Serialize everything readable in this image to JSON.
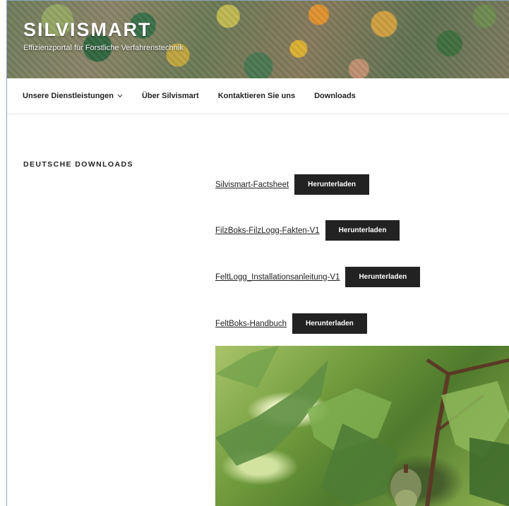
{
  "header": {
    "title": "SILVISMART",
    "tagline": "Effizienzportal für Forstliche Verfahrenstechnik"
  },
  "nav": {
    "items": [
      {
        "label": "Unsere Dienstleistungen",
        "has_dropdown": true
      },
      {
        "label": "Über Silvismart"
      },
      {
        "label": "Kontaktieren Sie uns"
      },
      {
        "label": "Downloads"
      }
    ]
  },
  "content": {
    "section_title": "DEUTSCHE DOWNLOADS",
    "downloads": [
      {
        "name": "Silvismart-Factsheet",
        "button": "Herunterladen"
      },
      {
        "name": "FilzBoks-FilzLogg-Fakten-V1",
        "button": "Herunterladen"
      },
      {
        "name": "FeltLogg_Installationsanleitung-V1",
        "button": "Herunterladen"
      },
      {
        "name": "FeltBoks-Handbuch",
        "button": "Herunterladen"
      }
    ]
  },
  "colors": {
    "button_bg": "#222222",
    "button_text": "#ffffff",
    "text": "#222222"
  }
}
